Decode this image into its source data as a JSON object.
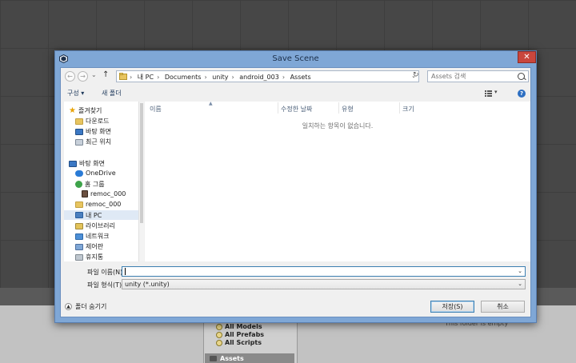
{
  "dialog": {
    "title": "Save Scene",
    "close_glyph": "✕"
  },
  "nav": {
    "back_glyph": "←",
    "forward_glyph": "→",
    "recent_glyph": "⌄",
    "up_glyph": "↑",
    "refresh_glyph": "↻",
    "breadcrumb": [
      "내 PC",
      "Documents",
      "unity",
      "android_003",
      "Assets"
    ],
    "search_placeholder": "Assets 검색"
  },
  "toolbar": {
    "organize": "구성 ▾",
    "new_folder": "새 폴더",
    "view_dropdown": "▾",
    "help": "?"
  },
  "sidebar": {
    "items": [
      {
        "label": "즐겨찾기",
        "icon": "star-icon"
      },
      {
        "label": "다운로드",
        "icon": "folder-icon"
      },
      {
        "label": "바탕 화면",
        "icon": "desktop-icon"
      },
      {
        "label": "최근 위치",
        "icon": "recent-places-icon"
      },
      {
        "label": "바탕 화면",
        "icon": "desktop-icon"
      },
      {
        "label": "OneDrive",
        "icon": "cloud-icon"
      },
      {
        "label": "홈 그룹",
        "icon": "homegroup-icon"
      },
      {
        "label": "remoc_000",
        "icon": "user-icon"
      },
      {
        "label": "remoc_000",
        "icon": "folder-icon"
      },
      {
        "label": "내 PC",
        "icon": "pc-icon"
      },
      {
        "label": "라이브러리",
        "icon": "library-icon"
      },
      {
        "label": "네트워크",
        "icon": "network-icon"
      },
      {
        "label": "제어판",
        "icon": "control-panel-icon"
      },
      {
        "label": "휴지통",
        "icon": "recycle-bin-icon"
      }
    ]
  },
  "filelist": {
    "columns": [
      "이름",
      "수정한 날짜",
      "유형",
      "크기"
    ],
    "empty_message": "일치하는 항목이 없습니다."
  },
  "form": {
    "filename_label": "파일 이름(N):",
    "filename_value": "",
    "filetype_label": "파일 형식(T):",
    "filetype_value": "unity (*.unity)"
  },
  "footer": {
    "hide_folders": "폴더 숨기기",
    "save": "저장(S)",
    "cancel": "취소"
  },
  "background": {
    "tree_items": [
      "All Models",
      "All Prefabs",
      "All Scripts"
    ],
    "assets_label": "Assets",
    "empty_folder": "This folder is empty"
  }
}
